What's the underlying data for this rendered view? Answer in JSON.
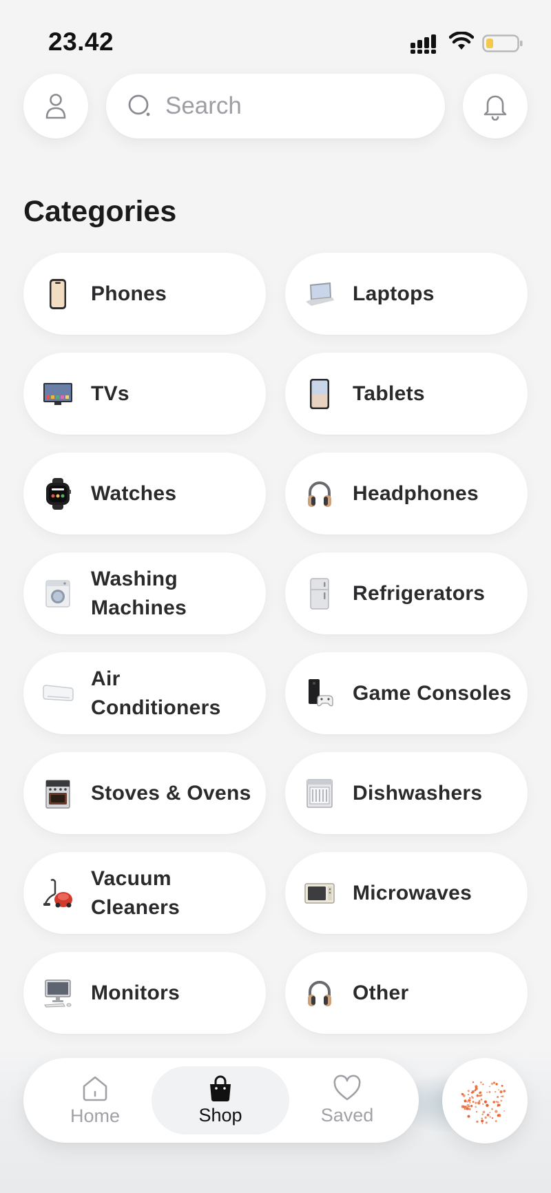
{
  "status_bar": {
    "time": "23.42",
    "battery_color": "#f2c94c"
  },
  "search": {
    "placeholder": "Search"
  },
  "categories": {
    "title": "Categories",
    "items": [
      {
        "label": "Phones",
        "icon": "phone-icon"
      },
      {
        "label": "Laptops",
        "icon": "laptop-icon"
      },
      {
        "label": "TVs",
        "icon": "tv-icon"
      },
      {
        "label": "Tablets",
        "icon": "tablet-icon"
      },
      {
        "label": "Watches",
        "icon": "watch-icon"
      },
      {
        "label": "Headphones",
        "icon": "headphones-icon"
      },
      {
        "label": "Washing Machines",
        "icon": "washing-machine-icon"
      },
      {
        "label": "Refrigerators",
        "icon": "refrigerator-icon"
      },
      {
        "label": "Air Conditioners",
        "icon": "air-conditioner-icon"
      },
      {
        "label": "Game Consoles",
        "icon": "game-console-icon"
      },
      {
        "label": "Stoves & Ovens",
        "icon": "stove-icon"
      },
      {
        "label": "Dishwashers",
        "icon": "dishwasher-icon"
      },
      {
        "label": "Vacuum Cleaners",
        "icon": "vacuum-icon"
      },
      {
        "label": "Microwaves",
        "icon": "microwave-icon"
      },
      {
        "label": "Monitors",
        "icon": "monitor-icon"
      },
      {
        "label": "Other",
        "icon": "headphones-icon"
      }
    ]
  },
  "nav": {
    "items": [
      {
        "label": "Home",
        "icon": "home-icon",
        "active": false
      },
      {
        "label": "Shop",
        "icon": "shopping-bag-icon",
        "active": true
      },
      {
        "label": "Saved",
        "icon": "heart-icon",
        "active": false
      }
    ],
    "ai_button_color": "#e8622c"
  }
}
